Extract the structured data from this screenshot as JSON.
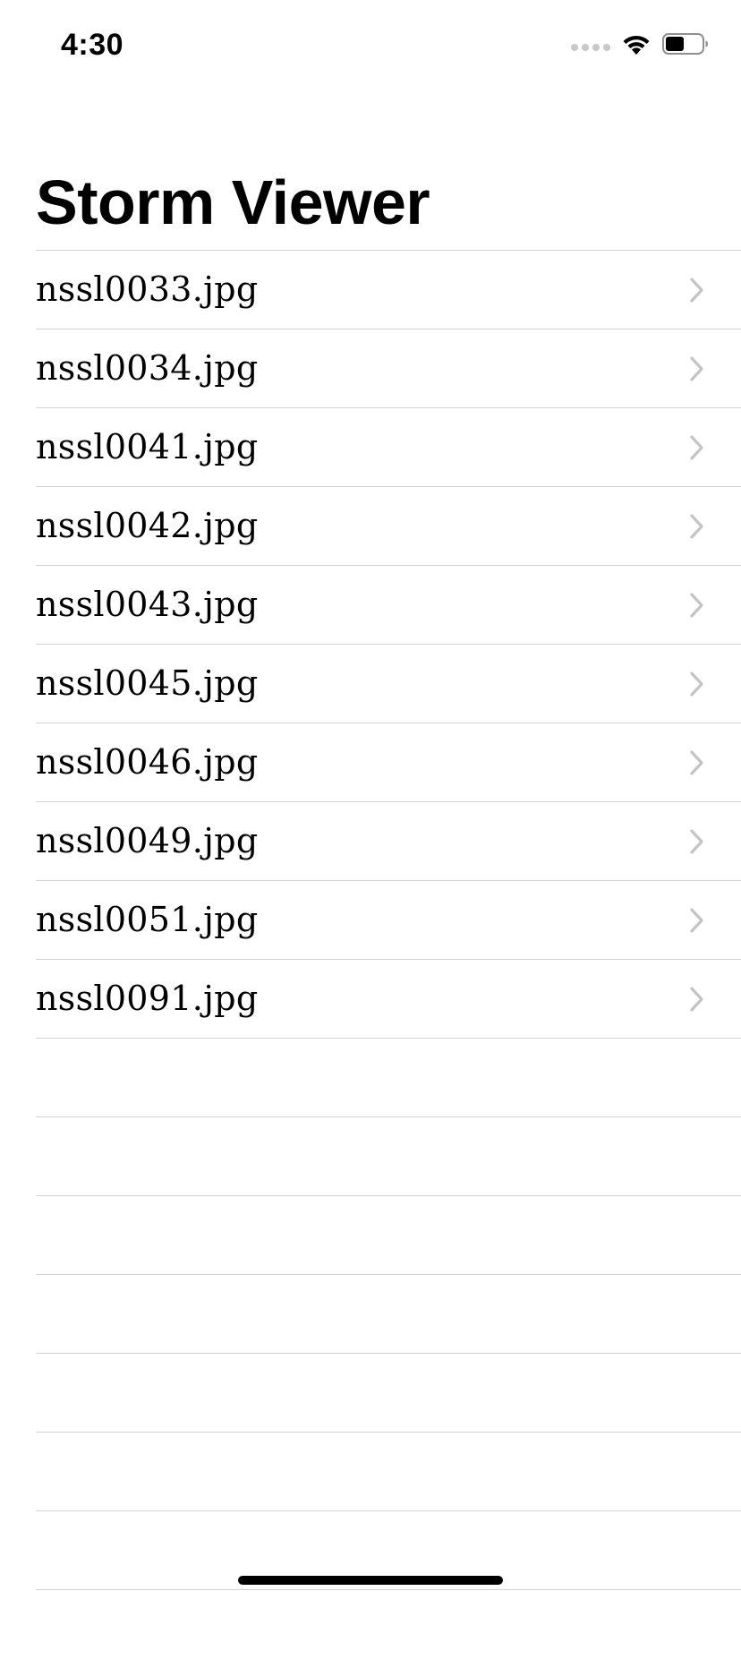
{
  "status_bar": {
    "time": "4:30",
    "signal_icon": "cellular-signal-dots",
    "wifi_icon": "wifi",
    "battery_icon": "battery-half"
  },
  "nav": {
    "title": "Storm Viewer"
  },
  "table": {
    "rows": [
      {
        "label": "nssl0033.jpg"
      },
      {
        "label": "nssl0034.jpg"
      },
      {
        "label": "nssl0041.jpg"
      },
      {
        "label": "nssl0042.jpg"
      },
      {
        "label": "nssl0043.jpg"
      },
      {
        "label": "nssl0045.jpg"
      },
      {
        "label": "nssl0046.jpg"
      },
      {
        "label": "nssl0049.jpg"
      },
      {
        "label": "nssl0051.jpg"
      },
      {
        "label": "nssl0091.jpg"
      }
    ],
    "chevron_icon": "chevron-right",
    "empty_row_count": 7
  },
  "colors": {
    "separator": "#d1d1d6",
    "chevron": "#c4c4c7",
    "text": "#000000",
    "background": "#ffffff"
  }
}
